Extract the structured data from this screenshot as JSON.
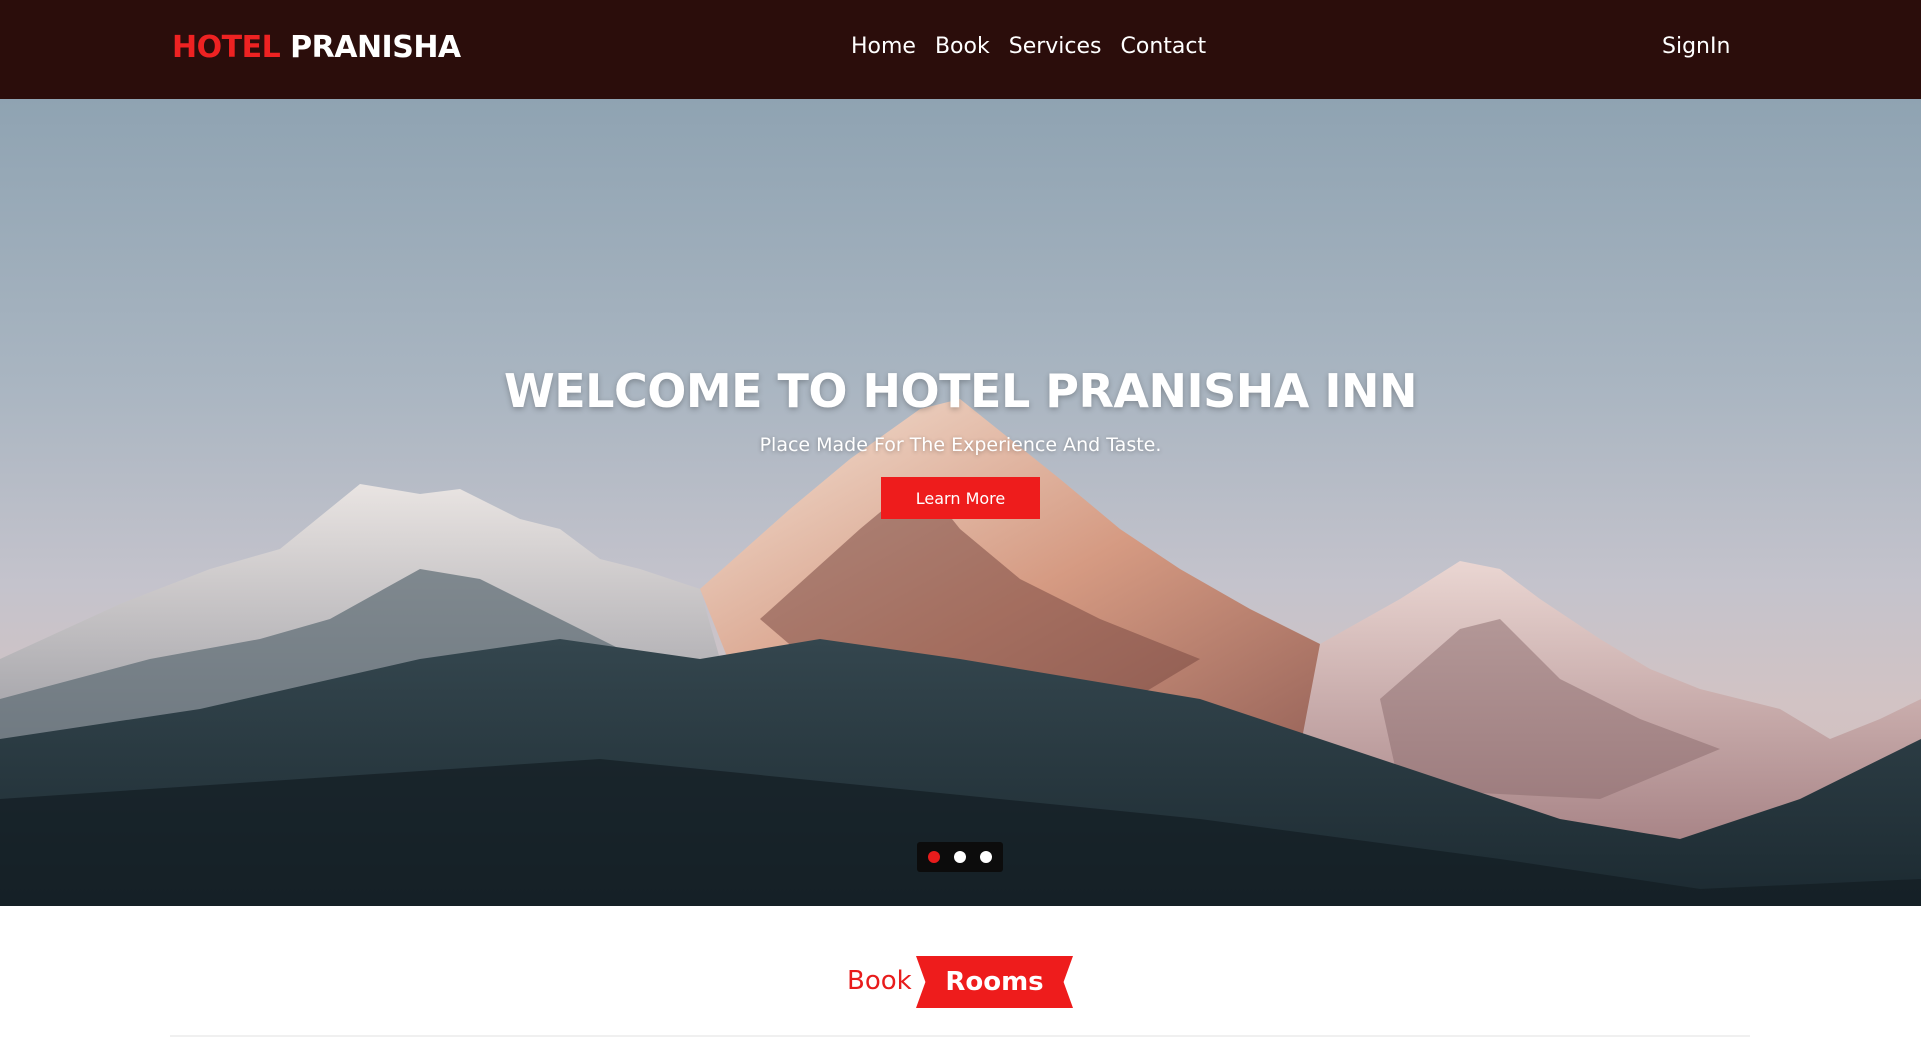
{
  "header": {
    "logo_part1": "HOTEL",
    "logo_part2": "PRANISHA",
    "nav": [
      {
        "label": "Home"
      },
      {
        "label": "Book"
      },
      {
        "label": "Services"
      },
      {
        "label": "Contact"
      }
    ],
    "signin_label": "SignIn"
  },
  "hero": {
    "title": "WELCOME TO HOTEL PRANISHA INN",
    "subtitle": "Place Made For The Experience And Taste.",
    "button_label": "Learn More",
    "carousel": {
      "slides": 3,
      "active_index": 0
    }
  },
  "section": {
    "heading_part1": "Book",
    "heading_part2": "Rooms"
  },
  "colors": {
    "header_bg": "#2b0d0b",
    "accent_red": "#ee1c1c",
    "text_white": "#ffffff"
  }
}
